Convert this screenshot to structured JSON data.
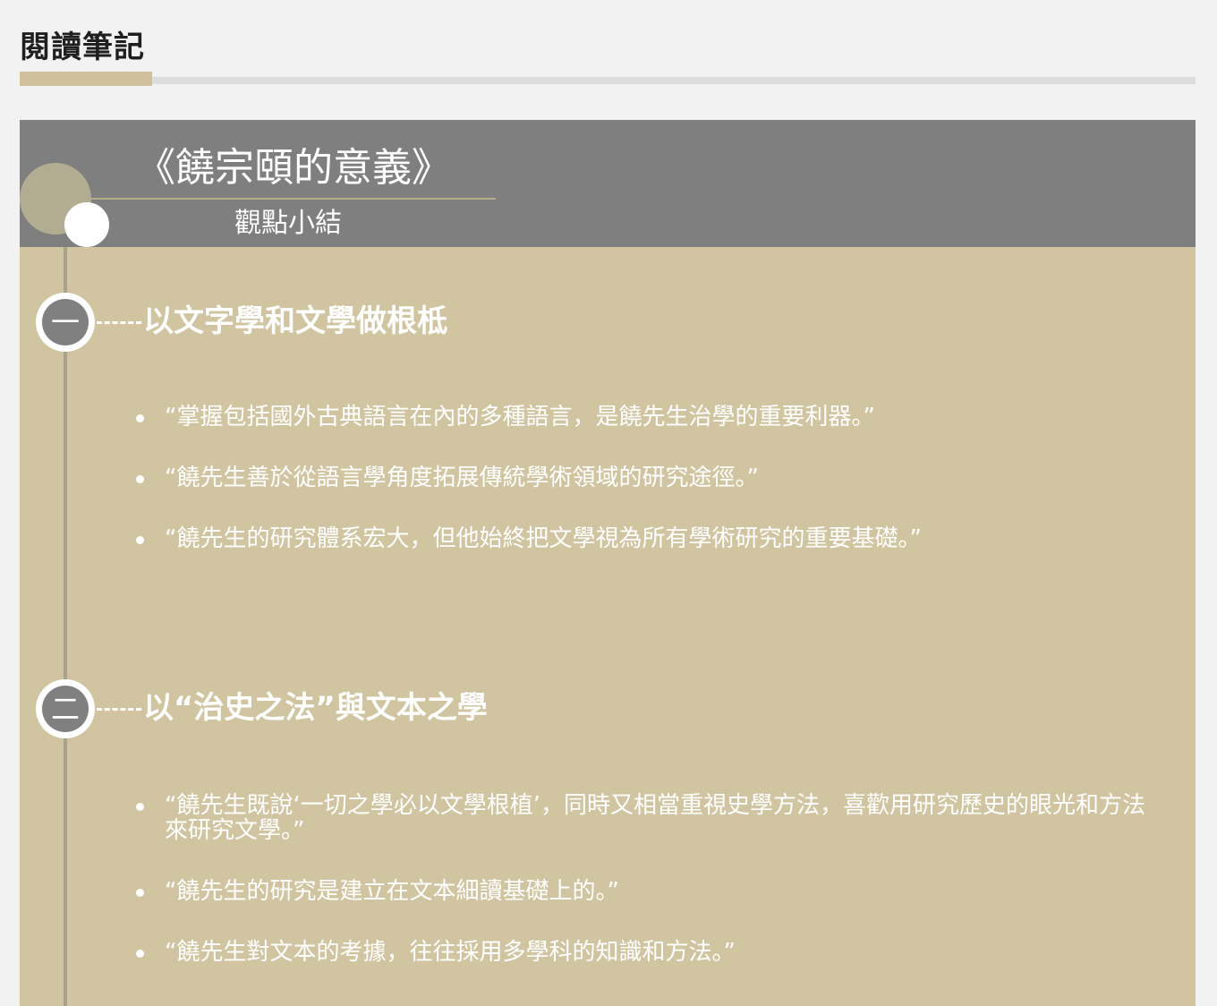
{
  "page": {
    "title": "閱讀筆記"
  },
  "book": {
    "title": "《饒宗頤的意義》",
    "subtitle": "觀點小結"
  },
  "sections": [
    {
      "numeral": "一",
      "title": "以文字學和文學做根柢",
      "quotes": [
        "“掌握包括國外古典語言在內的多種語言，是饒先生治學的重要利器。”",
        "“饒先生善於從語言學角度拓展傳統學術領域的研究途徑。”",
        "“饒先生的研究體系宏大，但他始終把文學視為所有學術研究的重要基礎。”"
      ]
    },
    {
      "numeral": "二",
      "title": "以“治史之法”與文本之學",
      "quotes": [
        "“饒先生既說‘一切之學必以文學根植’，同時又相當重視史學方法，喜歡用研究歷史的眼光和方法來研究文學。”",
        "“饒先生的研究是建立在文本細讀基礎上的。”",
        "“饒先生對文本的考據，往往採用多學科的知識和方法。”"
      ]
    }
  ],
  "colors": {
    "page_background": "#f2f2f3",
    "card_background": "#d1c5a1",
    "header_background": "#7f7f7f",
    "accent": "#cfc19b",
    "text_light": "#ffffff",
    "text_dark": "#1f1f1f"
  }
}
